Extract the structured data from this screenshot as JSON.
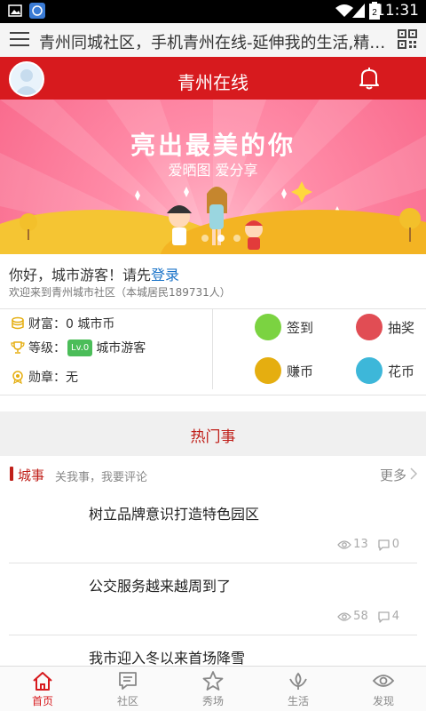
{
  "status": {
    "time": "11:31"
  },
  "urlbar": {
    "title": "青州同城社区，手机青州在线-延伸我的生活,精彩我..."
  },
  "header": {
    "title": "青州在线"
  },
  "banner": {
    "headline": "亮出最美的你",
    "sub": "爱晒图 爱分享"
  },
  "greeting": {
    "text": "你好，城市游客！请先",
    "login": "登录",
    "sub": "欢迎来到青州城市社区（本城居民189731人）"
  },
  "profile": {
    "wealth": "财富：0 城市币",
    "level_label": "等级：",
    "level_badge": "Lv.0",
    "level_name": "城市游客",
    "medal": "勋章：无"
  },
  "actions": [
    {
      "label": "签到",
      "color": "#7bd341"
    },
    {
      "label": "抽奖",
      "color": "#e14d54"
    },
    {
      "label": "赚币",
      "color": "#e5ae10"
    },
    {
      "label": "花币",
      "color": "#3db7d9"
    }
  ],
  "hot": {
    "title": "热门事"
  },
  "city": {
    "label": "城事",
    "desc": "关我事，我要评论",
    "more": "更多"
  },
  "news": [
    {
      "title": "树立品牌意识打造特色园区",
      "views": "13",
      "comments": "0"
    },
    {
      "title": "公交服务越来越周到了",
      "views": "58",
      "comments": "4"
    },
    {
      "title": "我市迎入冬以来首场降雪"
    }
  ],
  "tabs": [
    {
      "label": "首页",
      "icon": "home-icon"
    },
    {
      "label": "社区",
      "icon": "community-icon"
    },
    {
      "label": "秀场",
      "icon": "star-icon"
    },
    {
      "label": "生活",
      "icon": "life-icon"
    },
    {
      "label": "发现",
      "icon": "eye-icon"
    }
  ]
}
